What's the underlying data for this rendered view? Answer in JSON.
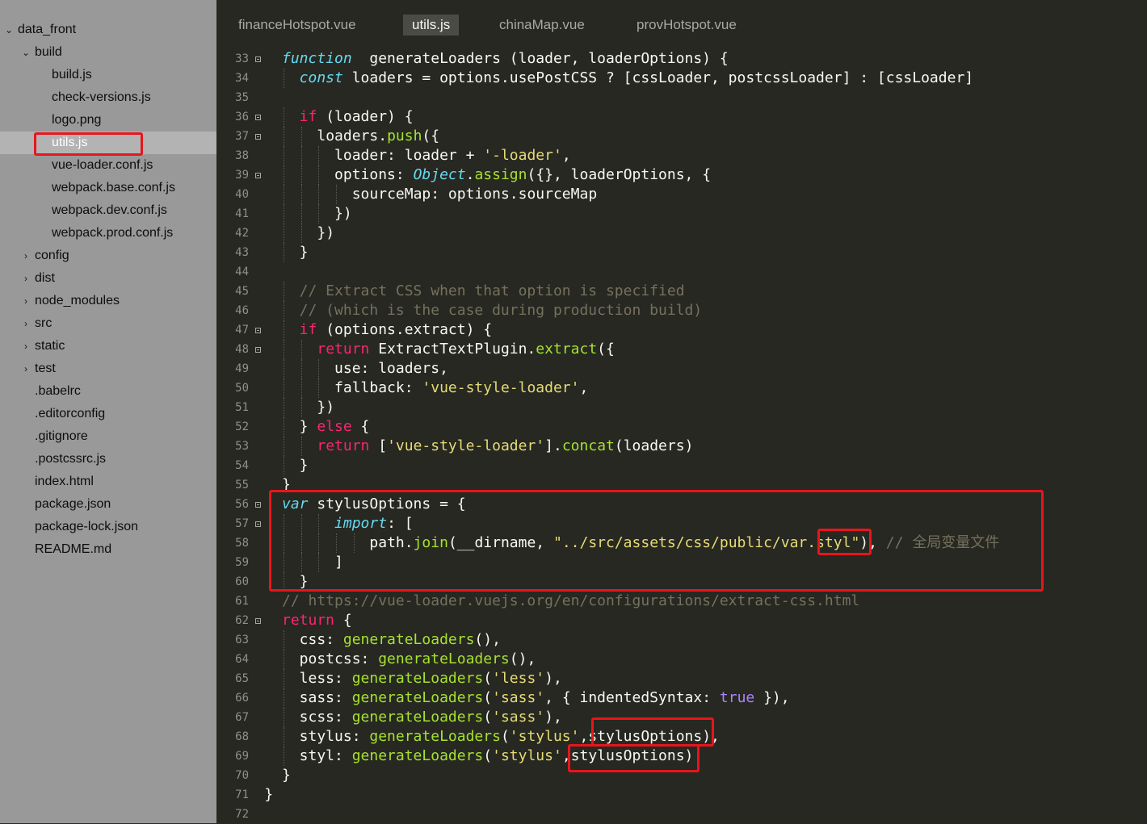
{
  "sidebar": {
    "items": [
      {
        "label": "data_front",
        "arrow": "⌄",
        "depth": 0
      },
      {
        "label": "build",
        "arrow": "⌄",
        "depth": 1
      },
      {
        "label": "build.js",
        "arrow": "",
        "depth": 2
      },
      {
        "label": "check-versions.js",
        "arrow": "",
        "depth": 2
      },
      {
        "label": "logo.png",
        "arrow": "",
        "depth": 2
      },
      {
        "label": "utils.js",
        "arrow": "",
        "depth": 2,
        "selected": true
      },
      {
        "label": "vue-loader.conf.js",
        "arrow": "",
        "depth": 2
      },
      {
        "label": "webpack.base.conf.js",
        "arrow": "",
        "depth": 2
      },
      {
        "label": "webpack.dev.conf.js",
        "arrow": "",
        "depth": 2
      },
      {
        "label": "webpack.prod.conf.js",
        "arrow": "",
        "depth": 2
      },
      {
        "label": "config",
        "arrow": "›",
        "depth": 1
      },
      {
        "label": "dist",
        "arrow": "›",
        "depth": 1
      },
      {
        "label": "node_modules",
        "arrow": "›",
        "depth": 1
      },
      {
        "label": "src",
        "arrow": "›",
        "depth": 1
      },
      {
        "label": "static",
        "arrow": "›",
        "depth": 1
      },
      {
        "label": "test",
        "arrow": "›",
        "depth": 1
      },
      {
        "label": ".babelrc",
        "arrow": "",
        "depth": 1
      },
      {
        "label": ".editorconfig",
        "arrow": "",
        "depth": 1
      },
      {
        "label": ".gitignore",
        "arrow": "",
        "depth": 1
      },
      {
        "label": ".postcssrc.js",
        "arrow": "",
        "depth": 1
      },
      {
        "label": "index.html",
        "arrow": "",
        "depth": 1
      },
      {
        "label": "package.json",
        "arrow": "",
        "depth": 1
      },
      {
        "label": "package-lock.json",
        "arrow": "",
        "depth": 1
      },
      {
        "label": "README.md",
        "arrow": "",
        "depth": 1
      }
    ]
  },
  "tabs": [
    {
      "label": "financeHotspot.vue",
      "active": false
    },
    {
      "label": "utils.js",
      "active": true
    },
    {
      "label": "chinaMap.vue",
      "active": false
    },
    {
      "label": "provHotspot.vue",
      "active": false
    }
  ],
  "colors": {
    "keyword_blue": "#66d9ef",
    "keyword_red": "#f92672",
    "function_green": "#a6e22e",
    "string_yellow": "#e6db74",
    "comment_gray": "#75715e",
    "highlight_red": "#e8151b"
  },
  "editor": {
    "lines": [
      {
        "num": "33",
        "fold": true,
        "indent": 0,
        "tokens": [
          [
            "kw-blue",
            "function"
          ],
          [
            "",
            "  generateLoaders (loader, loaderOptions) {"
          ]
        ]
      },
      {
        "num": "34",
        "fold": false,
        "indent": 1,
        "tokens": [
          [
            "kw-blue",
            "const"
          ],
          [
            "",
            " loaders = options.usePostCSS ? [cssLoader, postcssLoader] : [cssLoader]"
          ]
        ]
      },
      {
        "num": "35",
        "fold": false,
        "indent": 0,
        "tokens": []
      },
      {
        "num": "36",
        "fold": true,
        "indent": 1,
        "tokens": [
          [
            "kw-red",
            "if"
          ],
          [
            "",
            " (loader) {"
          ]
        ]
      },
      {
        "num": "37",
        "fold": true,
        "indent": 2,
        "tokens": [
          [
            "",
            "loaders."
          ],
          [
            "fn-green",
            "push"
          ],
          [
            "",
            "({"
          ]
        ]
      },
      {
        "num": "38",
        "fold": false,
        "indent": 3,
        "tokens": [
          [
            "",
            "loader: loader + "
          ],
          [
            "str",
            "'-loader'"
          ],
          [
            "",
            ","
          ]
        ]
      },
      {
        "num": "39",
        "fold": true,
        "indent": 3,
        "tokens": [
          [
            "",
            "options: "
          ],
          [
            "kw-blue",
            "Object"
          ],
          [
            "",
            "."
          ],
          [
            "fn-green",
            "assign"
          ],
          [
            "",
            "({}, loaderOptions, {"
          ]
        ]
      },
      {
        "num": "40",
        "fold": false,
        "indent": 4,
        "tokens": [
          [
            "",
            "sourceMap: options.sourceMap"
          ]
        ]
      },
      {
        "num": "41",
        "fold": false,
        "indent": 3,
        "tokens": [
          [
            "",
            "})"
          ]
        ]
      },
      {
        "num": "42",
        "fold": false,
        "indent": 2,
        "tokens": [
          [
            "",
            "})"
          ]
        ]
      },
      {
        "num": "43",
        "fold": false,
        "indent": 1,
        "tokens": [
          [
            "",
            "}"
          ]
        ]
      },
      {
        "num": "44",
        "fold": false,
        "indent": 0,
        "tokens": []
      },
      {
        "num": "45",
        "fold": false,
        "indent": 1,
        "tokens": [
          [
            "cmt",
            "// Extract CSS when that option is specified"
          ]
        ]
      },
      {
        "num": "46",
        "fold": false,
        "indent": 1,
        "tokens": [
          [
            "cmt",
            "// (which is the case during production build)"
          ]
        ]
      },
      {
        "num": "47",
        "fold": true,
        "indent": 1,
        "tokens": [
          [
            "kw-red",
            "if"
          ],
          [
            "",
            " (options.extract) {"
          ]
        ]
      },
      {
        "num": "48",
        "fold": true,
        "indent": 2,
        "tokens": [
          [
            "kw-red",
            "return"
          ],
          [
            "",
            " ExtractTextPlugin."
          ],
          [
            "fn-green",
            "extract"
          ],
          [
            "",
            "({"
          ]
        ]
      },
      {
        "num": "49",
        "fold": false,
        "indent": 3,
        "tokens": [
          [
            "",
            "use: loaders,"
          ]
        ]
      },
      {
        "num": "50",
        "fold": false,
        "indent": 3,
        "tokens": [
          [
            "",
            "fallback: "
          ],
          [
            "str",
            "'vue-style-loader'"
          ],
          [
            "",
            ","
          ]
        ]
      },
      {
        "num": "51",
        "fold": false,
        "indent": 2,
        "tokens": [
          [
            "",
            "})"
          ]
        ]
      },
      {
        "num": "52",
        "fold": false,
        "indent": 1,
        "tokens": [
          [
            "",
            "} "
          ],
          [
            "kw-red",
            "else"
          ],
          [
            "",
            " {"
          ]
        ]
      },
      {
        "num": "53",
        "fold": false,
        "indent": 2,
        "tokens": [
          [
            "kw-red",
            "return"
          ],
          [
            "",
            " ["
          ],
          [
            "str",
            "'vue-style-loader'"
          ],
          [
            "",
            "]."
          ],
          [
            "fn-green",
            "concat"
          ],
          [
            "",
            "(loaders)"
          ]
        ]
      },
      {
        "num": "54",
        "fold": false,
        "indent": 1,
        "tokens": [
          [
            "",
            "}"
          ]
        ]
      },
      {
        "num": "55",
        "fold": false,
        "indent": 0,
        "tokens": [
          [
            "",
            "}"
          ]
        ]
      },
      {
        "num": "56",
        "fold": true,
        "indent": 0,
        "tokens": [
          [
            "kw-blue",
            "var"
          ],
          [
            "",
            " stylusOptions = {"
          ]
        ]
      },
      {
        "num": "57",
        "fold": true,
        "indent": 3,
        "tokens": [
          [
            "kw-blue",
            "import"
          ],
          [
            "",
            ": ["
          ]
        ]
      },
      {
        "num": "58",
        "fold": false,
        "indent": 5,
        "tokens": [
          [
            "",
            "path."
          ],
          [
            "fn-green",
            "join"
          ],
          [
            "",
            "(__dirname, "
          ],
          [
            "str",
            "\"../src/assets/css/public/var.styl\""
          ],
          [
            "",
            "), "
          ],
          [
            "cmt",
            "// "
          ],
          [
            "cmt cn",
            "全局变量文件"
          ]
        ]
      },
      {
        "num": "59",
        "fold": false,
        "indent": 3,
        "tokens": [
          [
            "",
            "]"
          ]
        ]
      },
      {
        "num": "60",
        "fold": false,
        "indent": 1,
        "tokens": [
          [
            "",
            "}"
          ]
        ]
      },
      {
        "num": "61",
        "fold": false,
        "indent": 0,
        "tokens": [
          [
            "cmt",
            "// https://vue-loader.vuejs.org/en/configurations/extract-css.html"
          ]
        ]
      },
      {
        "num": "62",
        "fold": true,
        "indent": 0,
        "tokens": [
          [
            "kw-red",
            "return"
          ],
          [
            "",
            " {"
          ]
        ]
      },
      {
        "num": "63",
        "fold": false,
        "indent": 1,
        "tokens": [
          [
            "",
            "css: "
          ],
          [
            "fn-green",
            "generateLoaders"
          ],
          [
            "",
            "(),"
          ]
        ]
      },
      {
        "num": "64",
        "fold": false,
        "indent": 1,
        "tokens": [
          [
            "",
            "postcss: "
          ],
          [
            "fn-green",
            "generateLoaders"
          ],
          [
            "",
            "(),"
          ]
        ]
      },
      {
        "num": "65",
        "fold": false,
        "indent": 1,
        "tokens": [
          [
            "",
            "less: "
          ],
          [
            "fn-green",
            "generateLoaders"
          ],
          [
            "",
            "("
          ],
          [
            "str",
            "'less'"
          ],
          [
            "",
            "),"
          ]
        ]
      },
      {
        "num": "66",
        "fold": false,
        "indent": 1,
        "tokens": [
          [
            "",
            "sass: "
          ],
          [
            "fn-green",
            "generateLoaders"
          ],
          [
            "",
            "("
          ],
          [
            "str",
            "'sass'"
          ],
          [
            "",
            ", { indentedSyntax: "
          ],
          [
            "bool",
            "true"
          ],
          [
            "",
            " }),"
          ]
        ]
      },
      {
        "num": "67",
        "fold": false,
        "indent": 1,
        "tokens": [
          [
            "",
            "scss: "
          ],
          [
            "fn-green",
            "generateLoaders"
          ],
          [
            "",
            "("
          ],
          [
            "str",
            "'sass'"
          ],
          [
            "",
            "),"
          ]
        ]
      },
      {
        "num": "68",
        "fold": false,
        "indent": 1,
        "tokens": [
          [
            "",
            "stylus: "
          ],
          [
            "fn-green",
            "generateLoaders"
          ],
          [
            "",
            "("
          ],
          [
            "str",
            "'stylus'"
          ],
          [
            "",
            ",stylusOptions),"
          ]
        ]
      },
      {
        "num": "69",
        "fold": false,
        "indent": 1,
        "tokens": [
          [
            "",
            "styl: "
          ],
          [
            "fn-green",
            "generateLoaders"
          ],
          [
            "",
            "("
          ],
          [
            "str",
            "'stylus'"
          ],
          [
            "",
            ",stylusOptions)"
          ]
        ]
      },
      {
        "num": "70",
        "fold": false,
        "indent": 0,
        "tokens": [
          [
            "",
            "}"
          ]
        ]
      },
      {
        "num": "71",
        "fold": false,
        "indent": -1,
        "tokens": [
          [
            "",
            "}"
          ]
        ]
      },
      {
        "num": "72",
        "fold": false,
        "indent": 0,
        "tokens": []
      }
    ]
  }
}
